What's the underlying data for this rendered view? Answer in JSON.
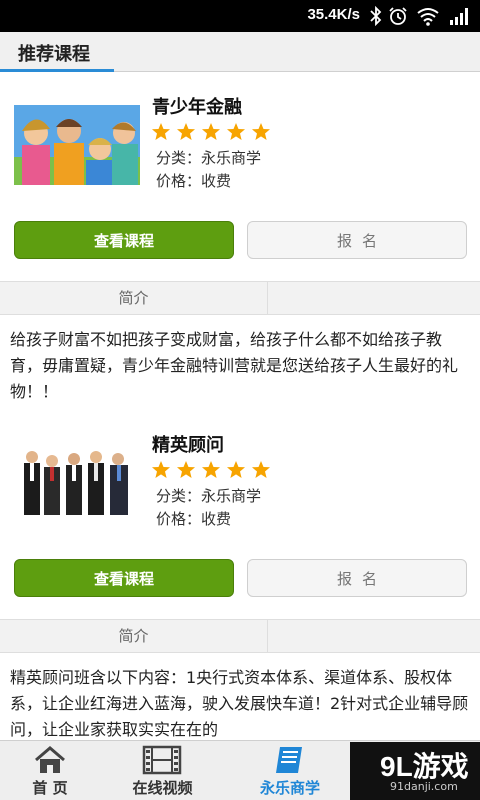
{
  "status_bar": {
    "speed": "35.4K/s"
  },
  "header": {
    "title": "推荐课程"
  },
  "courses": [
    {
      "name": "青少年金融",
      "rating": 5,
      "category": "分类：永乐商学",
      "price": "价格：收费",
      "view_button": "查看课程",
      "signup_button": "报名",
      "intro_tab": "简介",
      "description": "给孩子财富不如把孩子变成财富，给孩子什么都不如给孩子教育，毋庸置疑，青少年金融特训营就是您送给孩子人生最好的礼物！！"
    },
    {
      "name": "精英顾问",
      "rating": 5,
      "category": "分类：永乐商学",
      "price": "价格：收费",
      "view_button": "查看课程",
      "signup_button": "报名",
      "intro_tab": "简介",
      "description": "精英顾问班含以下内容：1央行式资本体系、渠道体系、股权体系，让企业红海进入蓝海，驶入发展快车道！2针对式企业辅导顾问，让企业家获取实实在在的"
    }
  ],
  "bottom_nav": {
    "items": [
      {
        "label": "首 页",
        "icon": "home-icon"
      },
      {
        "label": "在线视频",
        "icon": "film-icon"
      },
      {
        "label": "永乐商学",
        "icon": "book-icon",
        "active": true
      }
    ]
  },
  "brand": {
    "logo_text": "9L游戏",
    "url_text": "91danji.com"
  },
  "colors": {
    "accent": "#1f86d6",
    "button_green": "#5e9e10",
    "star": "#f7a400"
  }
}
